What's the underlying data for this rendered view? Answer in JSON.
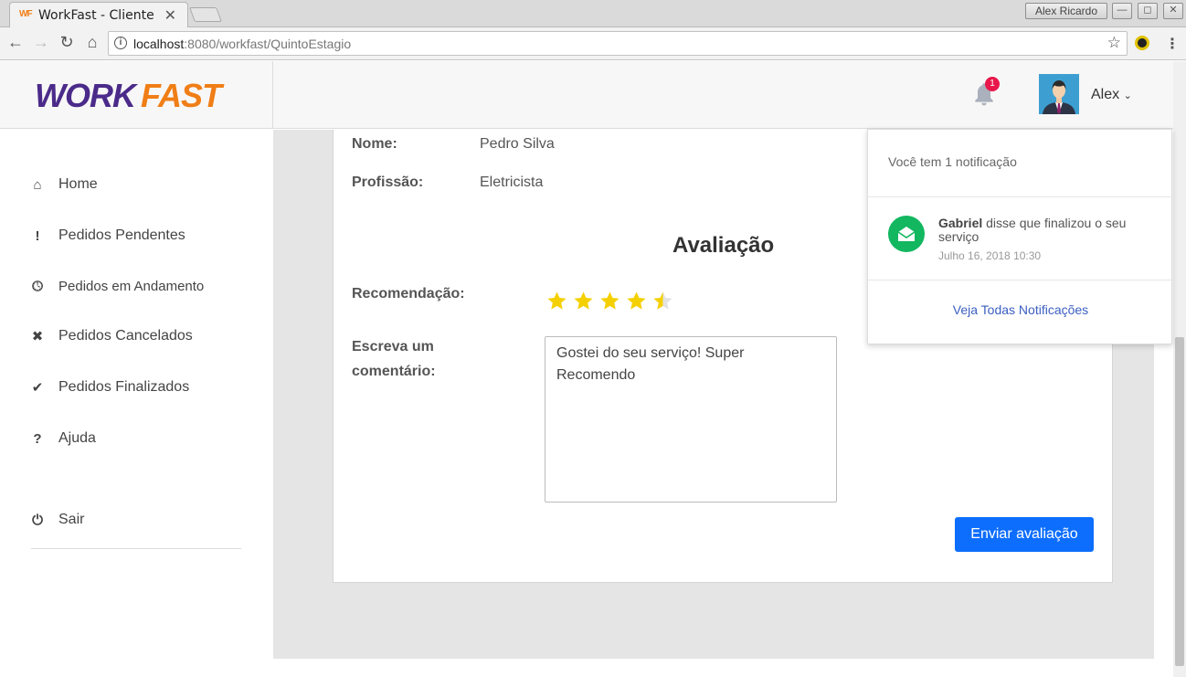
{
  "browser": {
    "tab_title": "WorkFast - Cliente",
    "tab_close": "✕",
    "favicon_text": "WF",
    "window_user": "Alex Ricardo",
    "url_host": "localhost",
    "url_path": ":8080/workfast/QuintoEstagio"
  },
  "brand": {
    "part1": "WORK",
    "part2": "FAST",
    "color_primary": "#4b2b8a",
    "color_accent": "#f07e16"
  },
  "header": {
    "notification_count": "1",
    "user_name": "Alex"
  },
  "sidebar": {
    "items": [
      {
        "label": "Home",
        "icon": "home-icon"
      },
      {
        "label": "Pedidos Pendentes",
        "icon": "exclamation-icon"
      },
      {
        "label": "Pedidos em Andamento",
        "icon": "clock-icon"
      },
      {
        "label": "Pedidos Cancelados",
        "icon": "x-icon"
      },
      {
        "label": "Pedidos Finalizados",
        "icon": "check-icon"
      },
      {
        "label": "Ajuda",
        "icon": "question-icon"
      }
    ],
    "logout": {
      "label": "Sair",
      "icon": "power-icon"
    }
  },
  "profile": {
    "name_label": "Nome:",
    "name_value": "Pedro Silva",
    "profession_label": "Profissão:",
    "profession_value": "Eletricista"
  },
  "rating": {
    "title": "Avaliação",
    "recommendation_label": "Recomendação:",
    "stars": 4.5,
    "max_stars": 5,
    "star_color": "#f5d000",
    "comment_label_line1": "Escreva um",
    "comment_label_line2": "comentário:",
    "comment_value": "Gostei do seu serviço! Super Recomendo",
    "submit_label": "Enviar avaliação",
    "submit_color": "#0d6efd"
  },
  "notifications": {
    "header": "Você tem 1 notificação",
    "items": [
      {
        "author": "Gabriel",
        "text": " disse que finalizou o seu serviço",
        "time": "Julho 16, 2018 10:30"
      }
    ],
    "see_all": "Veja Todas Notificações"
  }
}
